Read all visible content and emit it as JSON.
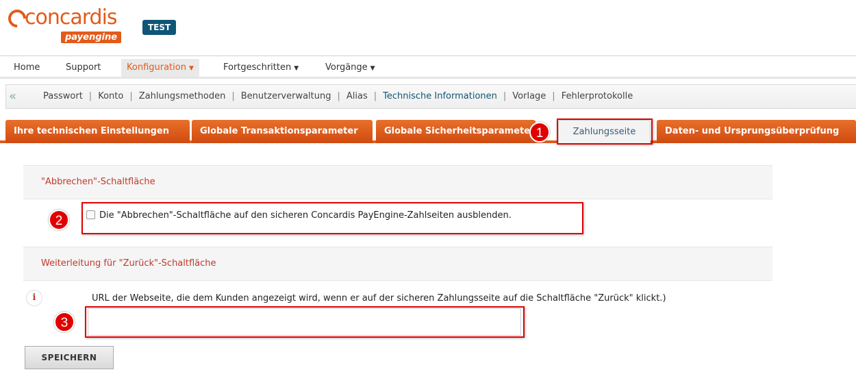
{
  "brand": {
    "logo_main": "concardis",
    "logo_sub": "payengine",
    "env_badge": "TEST"
  },
  "mainnav": {
    "items": [
      {
        "label": "Home"
      },
      {
        "label": "Support"
      },
      {
        "label": "Konfiguration"
      },
      {
        "label": "Fortgeschritten"
      },
      {
        "label": "Vorgänge"
      }
    ]
  },
  "subnav": {
    "collapse_icon": "«",
    "links": [
      "Passwort",
      "Konto",
      "Zahlungsmethoden",
      "Benutzerverwaltung",
      "Alias",
      "Technische Informationen",
      "Vorlage",
      "Fehlerprotokolle"
    ],
    "separator": "|"
  },
  "tabs": [
    {
      "label": "Ihre technischen Einstellungen"
    },
    {
      "label": "Globale Transaktionsparameter"
    },
    {
      "label": "Globale Sicherheitsparameter"
    },
    {
      "label": "Zahlungsseite"
    },
    {
      "label": "Daten- und Ursprungsüberprüfung"
    }
  ],
  "markers": [
    "1",
    "2",
    "3"
  ],
  "section_cancel": {
    "title": "\"Abbrechen\"-Schaltfläche",
    "checkbox_label": "Die \"Abbrechen\"-Schaltfläche auf den sicheren Concardis PayEngine-Zahlseiten ausblenden."
  },
  "section_back": {
    "title": "Weiterleitung für \"Zurück\"-Schaltfläche",
    "info_icon": "i",
    "help_text": "URL der Webseite, die dem Kunden angezeigt wird, wenn er auf der sicheren Zahlungsseite auf die Schaltfläche \"Zurück\" klickt.)",
    "url_value": ""
  },
  "save_label": "SPEICHERN",
  "colors": {
    "brand": "#e35a1a",
    "badge": "#0f5676",
    "marker": "#e00000"
  }
}
